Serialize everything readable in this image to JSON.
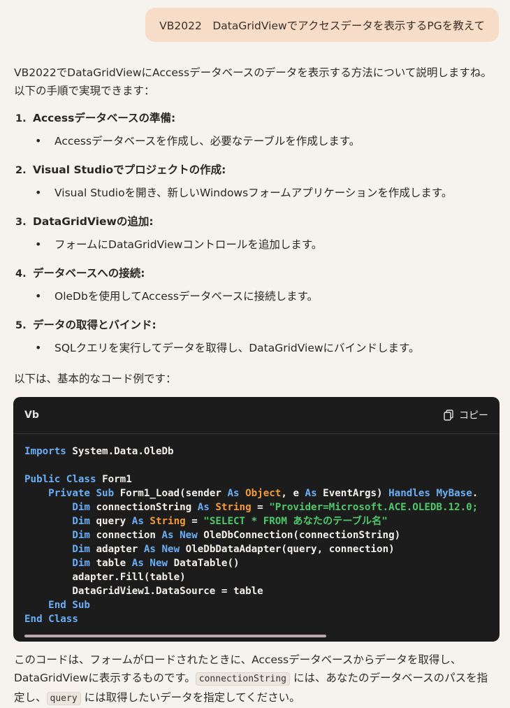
{
  "user_message": "VB2022　DataGridViewでアクセスデータを表示するPGを教えて",
  "intro": "VB2022でDataGridViewにAccessデータベースのデータを表示する方法について説明しますね。以下の手順で実現できます：",
  "steps": [
    {
      "num": "1.",
      "title": "Accessデータベースの準備:",
      "bullet": "Accessデータベースを作成し、必要なテーブルを作成します。"
    },
    {
      "num": "2.",
      "title": "Visual Studioでプロジェクトの作成:",
      "bullet": "Visual Studioを開き、新しいWindowsフォームアプリケーションを作成します。"
    },
    {
      "num": "3.",
      "title": "DataGridViewの追加:",
      "bullet": "フォームにDataGridViewコントロールを追加します。"
    },
    {
      "num": "4.",
      "title": "データベースへの接続:",
      "bullet": "OleDbを使用してAccessデータベースに接続します。"
    },
    {
      "num": "5.",
      "title": "データの取得とバインド:",
      "bullet": "SQLクエリを実行してデータを取得し、DataGridViewにバインドします。"
    }
  ],
  "code_intro": "以下は、基本的なコード例です：",
  "code_block": {
    "language": "Vb",
    "copy_label": "コピー",
    "lines": [
      "Imports System.Data.OleDb",
      "",
      "Public Class Form1",
      "    Private Sub Form1_Load(sender As Object, e As EventArgs) Handles MyBase.",
      "        Dim connectionString As String = \"Provider=Microsoft.ACE.OLEDB.12.0;",
      "        Dim query As String = \"SELECT * FROM あなたのテーブル名\"",
      "        Dim connection As New OleDbConnection(connectionString)",
      "        Dim adapter As New OleDbDataAdapter(query, connection)",
      "        Dim table As New DataTable()",
      "        adapter.Fill(table)",
      "        DataGridView1.DataSource = table",
      "    End Sub",
      "End Class"
    ]
  },
  "outro": {
    "part1": "このコードは、フォームがロードされたときに、Accessデータベースからデータを取得し、DataGridViewに表示するものです。",
    "code1": "connectionString",
    "part2": " には、あなたのデータベースのパスを指定し、",
    "code2": "query",
    "part3": " には取得したいデータを指定してください。"
  },
  "colors": {
    "keyword": "#6aaef5",
    "type": "#f39a3a",
    "string": "#4fc76b",
    "code_bg": "#1d1c1c",
    "user_bubble": "#f7dcc8"
  }
}
